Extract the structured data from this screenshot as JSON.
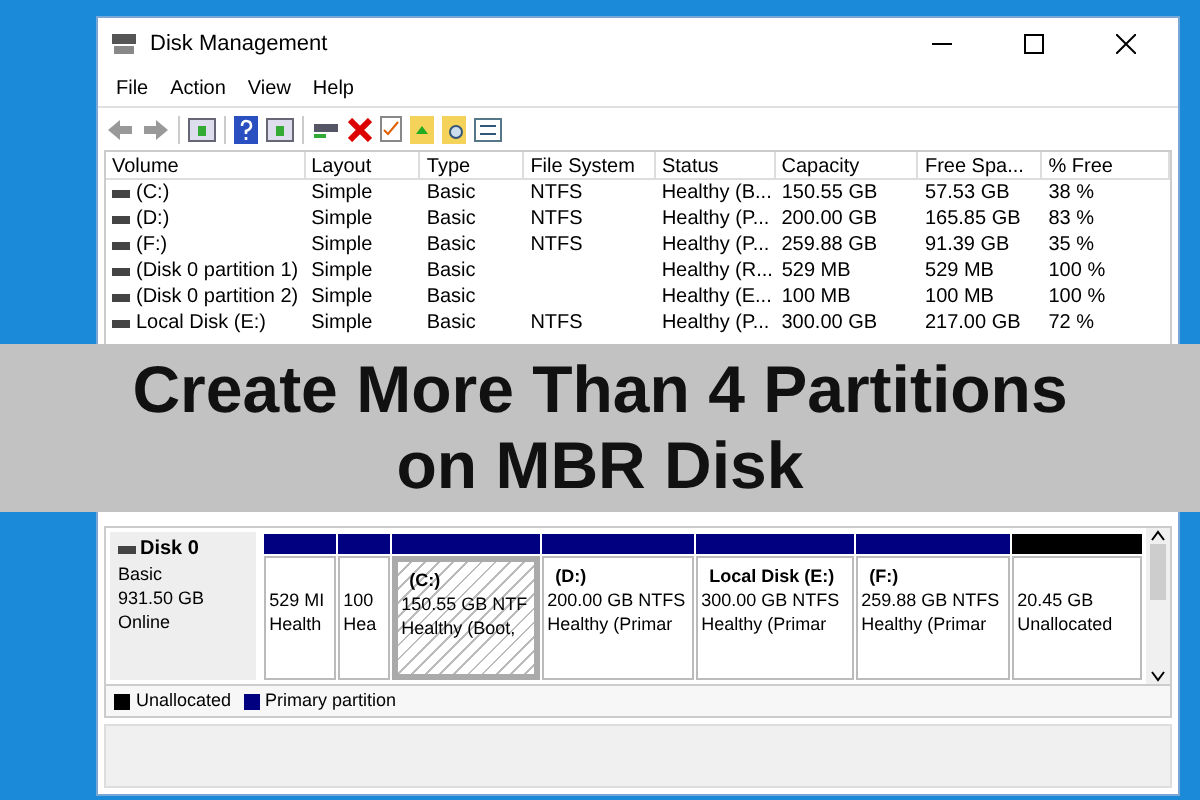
{
  "window": {
    "title": "Disk Management"
  },
  "menu": [
    "File",
    "Action",
    "View",
    "Help"
  ],
  "table": {
    "columns": [
      "Volume",
      "Layout",
      "Type",
      "File System",
      "Status",
      "Capacity",
      "Free Spa...",
      "% Free"
    ],
    "rows": [
      [
        "(C:)",
        "Simple",
        "Basic",
        "NTFS",
        "Healthy (B...",
        "150.55 GB",
        "57.53 GB",
        "38 %"
      ],
      [
        "(D:)",
        "Simple",
        "Basic",
        "NTFS",
        "Healthy (P...",
        "200.00 GB",
        "165.85 GB",
        "83 %"
      ],
      [
        "(F:)",
        "Simple",
        "Basic",
        "NTFS",
        "Healthy (P...",
        "259.88 GB",
        "91.39 GB",
        "35 %"
      ],
      [
        "(Disk 0 partition 1)",
        "Simple",
        "Basic",
        "",
        "Healthy (R...",
        "529 MB",
        "529 MB",
        "100 %"
      ],
      [
        "(Disk 0 partition 2)",
        "Simple",
        "Basic",
        "",
        "Healthy (E...",
        "100 MB",
        "100 MB",
        "100 %"
      ],
      [
        "Local Disk  (E:)",
        "Simple",
        "Basic",
        "NTFS",
        "Healthy (P...",
        "300.00 GB",
        "217.00 GB",
        "72 %"
      ]
    ]
  },
  "banner": {
    "line_1": "Create More Than 4 Partitions",
    "line_2": "on MBR Disk"
  },
  "disk": {
    "name": "Disk 0",
    "type": "Basic",
    "size": "931.50 GB",
    "state": "Online"
  },
  "partitions": [
    {
      "kind": "primary",
      "selected": false,
      "size": "529 MI",
      "status": "Health"
    },
    {
      "kind": "primary",
      "selected": false,
      "size": "100",
      "status": "Hea"
    },
    {
      "kind": "primary",
      "selected": true,
      "label": "(C:)",
      "size": "150.55 GB NTF",
      "status": "Healthy (Boot,"
    },
    {
      "kind": "primary",
      "selected": false,
      "label": "(D:)",
      "size": "200.00 GB NTFS",
      "status": "Healthy (Primar"
    },
    {
      "kind": "primary",
      "selected": false,
      "label": "Local Disk   (E:)",
      "size": "300.00 GB NTFS",
      "status": "Healthy (Primar"
    },
    {
      "kind": "primary",
      "selected": false,
      "label": "(F:)",
      "size": "259.88 GB NTFS",
      "status": "Healthy (Primar"
    },
    {
      "kind": "unallocated",
      "selected": false,
      "size": "20.45 GB",
      "status": "Unallocated"
    }
  ],
  "legend": [
    {
      "label": "Unallocated",
      "color": "#000000"
    },
    {
      "label": "Primary partition",
      "color": "#000080"
    }
  ]
}
